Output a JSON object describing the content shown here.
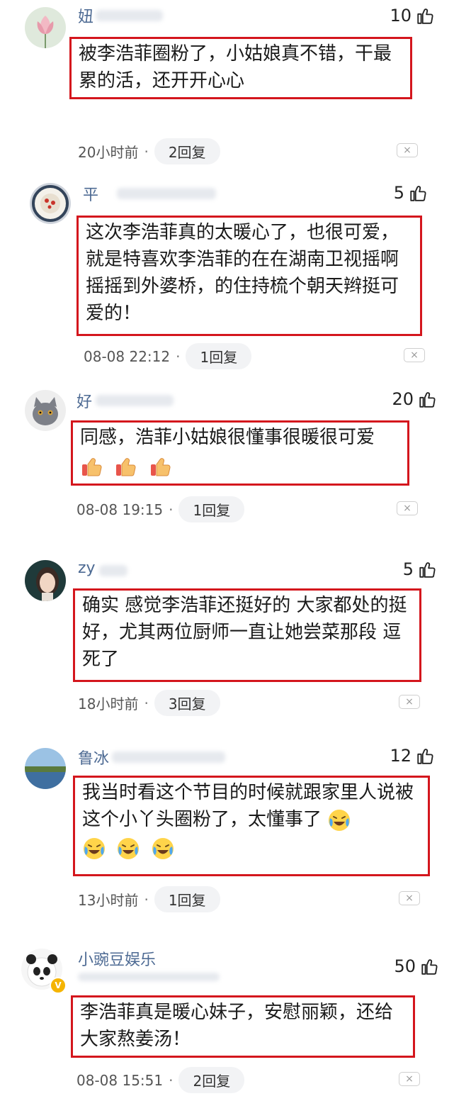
{
  "comments": [
    {
      "username": "妞",
      "likes": "10",
      "text": "被李浩菲圈粉了，小姑娘真不错，干最累的活，还开开心心",
      "time": "20小时前",
      "replies": "2回复",
      "emojis": []
    },
    {
      "username": "平",
      "likes": "5",
      "text": "这次李浩菲真的太暖心了，也很可爱，就是特喜欢李浩菲的在在湖南卫视摇啊摇摇到外婆桥，的住持梳个朝天辫挺可爱的！",
      "time": "08-08 22:12",
      "replies": "1回复",
      "emojis": []
    },
    {
      "username": "好",
      "likes": "20",
      "text": "同感，浩菲小姑娘很懂事很暖很可爱",
      "time": "08-08 19:15",
      "replies": "1回复",
      "emojis": [
        "thumbs-up",
        "thumbs-up",
        "thumbs-up"
      ]
    },
    {
      "username": "zy",
      "likes": "5",
      "text": "确实 感觉李浩菲还挺好的 大家都处的挺好，尤其两位厨师一直让她尝菜那段 逗死了",
      "time": "18小时前",
      "replies": "3回复",
      "emojis": []
    },
    {
      "username": "鲁冰",
      "likes": "12",
      "text": "我当时看这个节目的时候就跟家里人说被这个小丫头圈粉了，太懂事了",
      "time": "13小时前",
      "replies": "1回复",
      "emojis": [
        "laugh-cry",
        "laugh-cry",
        "laugh-cry",
        "laugh-cry"
      ]
    },
    {
      "username": "小豌豆娱乐",
      "likes": "50",
      "text": "李浩菲真是暖心妹子，安慰丽颖，还给大家熬姜汤！",
      "time": "08-08 15:51",
      "replies": "2回复",
      "emojis": []
    }
  ],
  "icons": {
    "like": "thumbs-up-outline-icon",
    "dismiss": "close-icon"
  },
  "colors": {
    "highlight_border": "#d4161d",
    "username": "#4d6a93"
  },
  "symbols": {
    "dismiss": "×",
    "dot": "·"
  }
}
